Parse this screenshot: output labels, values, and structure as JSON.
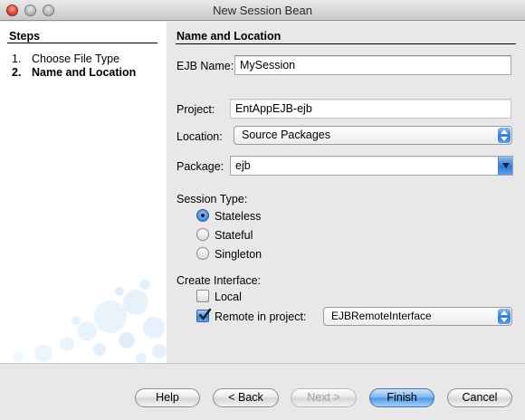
{
  "window": {
    "title": "New Session Bean"
  },
  "steps": {
    "heading": "Steps",
    "items": [
      {
        "num": "1.",
        "label": "Choose File Type"
      },
      {
        "num": "2.",
        "label": "Name and Location"
      }
    ]
  },
  "main": {
    "section_title": "Name and Location",
    "ejb_name": {
      "label": "EJB Name:",
      "value": "MySession"
    },
    "project": {
      "label": "Project:",
      "value": "EntAppEJB-ejb"
    },
    "location": {
      "label": "Location:",
      "value": "Source Packages"
    },
    "package": {
      "label": "Package:",
      "value": "ejb"
    },
    "session_type": {
      "label": "Session Type:",
      "options": [
        "Stateless",
        "Stateful",
        "Singleton"
      ],
      "selected": "Stateless"
    },
    "create_interface": {
      "label": "Create Interface:",
      "local": {
        "label": "Local",
        "checked": false
      },
      "remote": {
        "label": "Remote in project:",
        "checked": true,
        "project_value": "EJBRemoteInterface"
      }
    }
  },
  "buttons": {
    "help": "Help",
    "back": "< Back",
    "next": "Next >",
    "finish": "Finish",
    "cancel": "Cancel"
  },
  "colors": {
    "accent": "#3f87dc",
    "default_button": "#78b2ef"
  }
}
